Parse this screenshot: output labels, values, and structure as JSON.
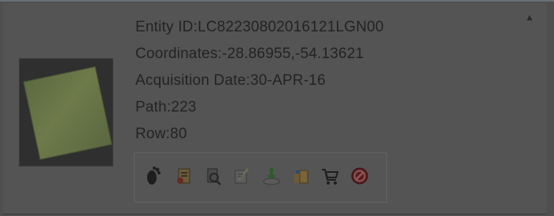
{
  "result": {
    "entity_id": "Entity ID:LC82230802016121LGN00",
    "coordinates": "Coordinates:-28.86955,-54.13621",
    "acquisition_date": "Acquisition Date:30-APR-16",
    "path": "Path:223",
    "row": "Row:80"
  },
  "toolbar": {
    "icons": [
      "footprint-icon",
      "metadata-icon",
      "compare-icon",
      "order-scene-icon",
      "download-icon",
      "bulk-download-icon",
      "cart-icon",
      "exclude-icon"
    ]
  },
  "colors": {
    "overlay_background": "#545454",
    "text": "#232323"
  }
}
